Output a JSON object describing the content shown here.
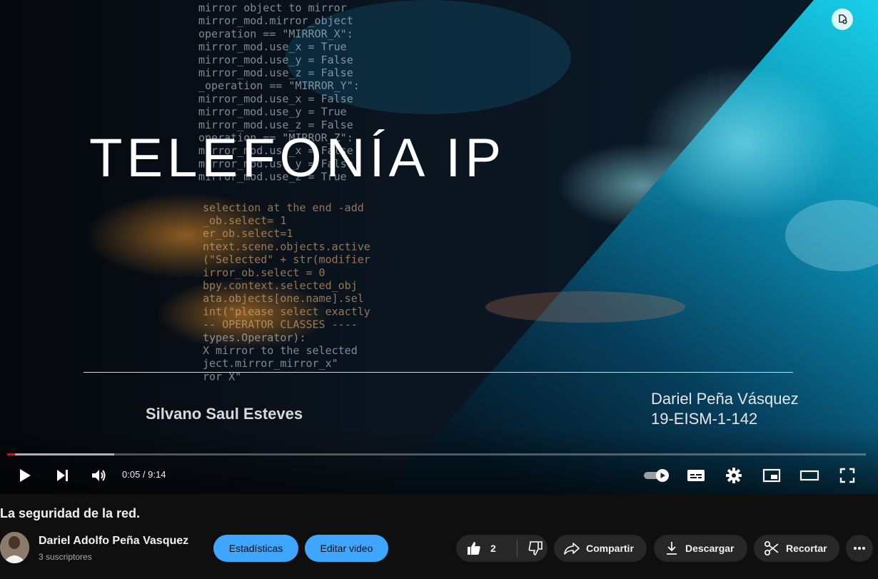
{
  "slide": {
    "title": "TELEFONÍA IP",
    "author_left": "Silvano Saul Esteves",
    "author_right_name": "Dariel Peña Vásquez",
    "author_right_id": "19-EISM-1-142",
    "code_lines": [
      "mirror object to mirror",
      "mirror_mod.mirror_object",
      "operation == \"MIRROR_X\":",
      "mirror_mod.use_x = True",
      "mirror_mod.use_y = False",
      "mirror_mod.use_z = False",
      "_operation == \"MIRROR_Y\":",
      "mirror_mod.use_x = False",
      "mirror_mod.use_y = True",
      "mirror_mod.use_z = False",
      "operation == \"MIRROR_Z\":",
      "mirror_mod.use_x = False",
      "mirror_mod.use_y = False",
      "mirror_mod.use_z = True",
      "selection at the end -add",
      "_ob.select= 1",
      "er_ob.select=1",
      "ntext.scene.objects.active",
      "(\"Selected\" + str(modifier",
      "irror_ob.select = 0",
      "bpy.context.selected_obj",
      "ata.objects[one.name].sel",
      "int(\"please select exactly",
      "-- OPERATOR CLASSES ----",
      "types.Operator):",
      "X mirror to the selected",
      "ject.mirror_mirror_x\"",
      "ror X\""
    ]
  },
  "player": {
    "time": "0:05 / 9:14",
    "progress_played": 0.009,
    "progress_buffered": 0.125,
    "icons": {
      "play": "play-icon",
      "next": "next-icon",
      "volume": "volume-icon",
      "autoplay": "autoplay-toggle-icon",
      "subtitles": "subtitles-icon",
      "settings": "gear-icon",
      "miniplayer": "miniplayer-icon",
      "theater": "theater-icon",
      "fullscreen": "fullscreen-icon",
      "badge": "playlist-badge-icon"
    }
  },
  "video": {
    "title": "La seguridad de la red.",
    "channel": "Dariel Adolfo Peña Vasquez",
    "subscribers": "3 suscriptores"
  },
  "actions": {
    "stats_label": "Estadísticas",
    "edit_label": "Editar video",
    "likes": "2",
    "share_label": "Compartir",
    "download_label": "Descargar",
    "clip_label": "Recortar"
  },
  "colors": {
    "accent_blue": "#3ea6ff",
    "progress_red": "#ff0000",
    "pill_bg": "#272727",
    "page_bg": "#0f0f0f"
  }
}
